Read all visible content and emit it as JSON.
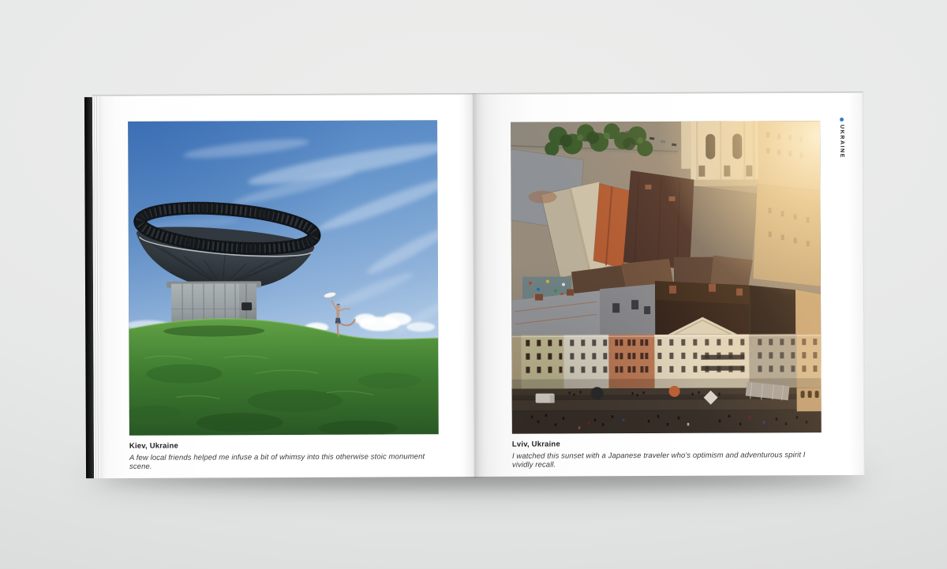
{
  "pages": {
    "left": {
      "title": "Kiev, Ukraine",
      "caption": "A few local friends helped me infuse a bit of whimsy into this otherwise stoic monument scene."
    },
    "right": {
      "title": "Lviv, Ukraine",
      "caption": "I watched this sunset with a Japanese traveler who's optimism and adventurous spirit I vividly recall.",
      "edge_label": "UKRAINE"
    }
  },
  "colors": {
    "accent": "#2e7cd0"
  }
}
